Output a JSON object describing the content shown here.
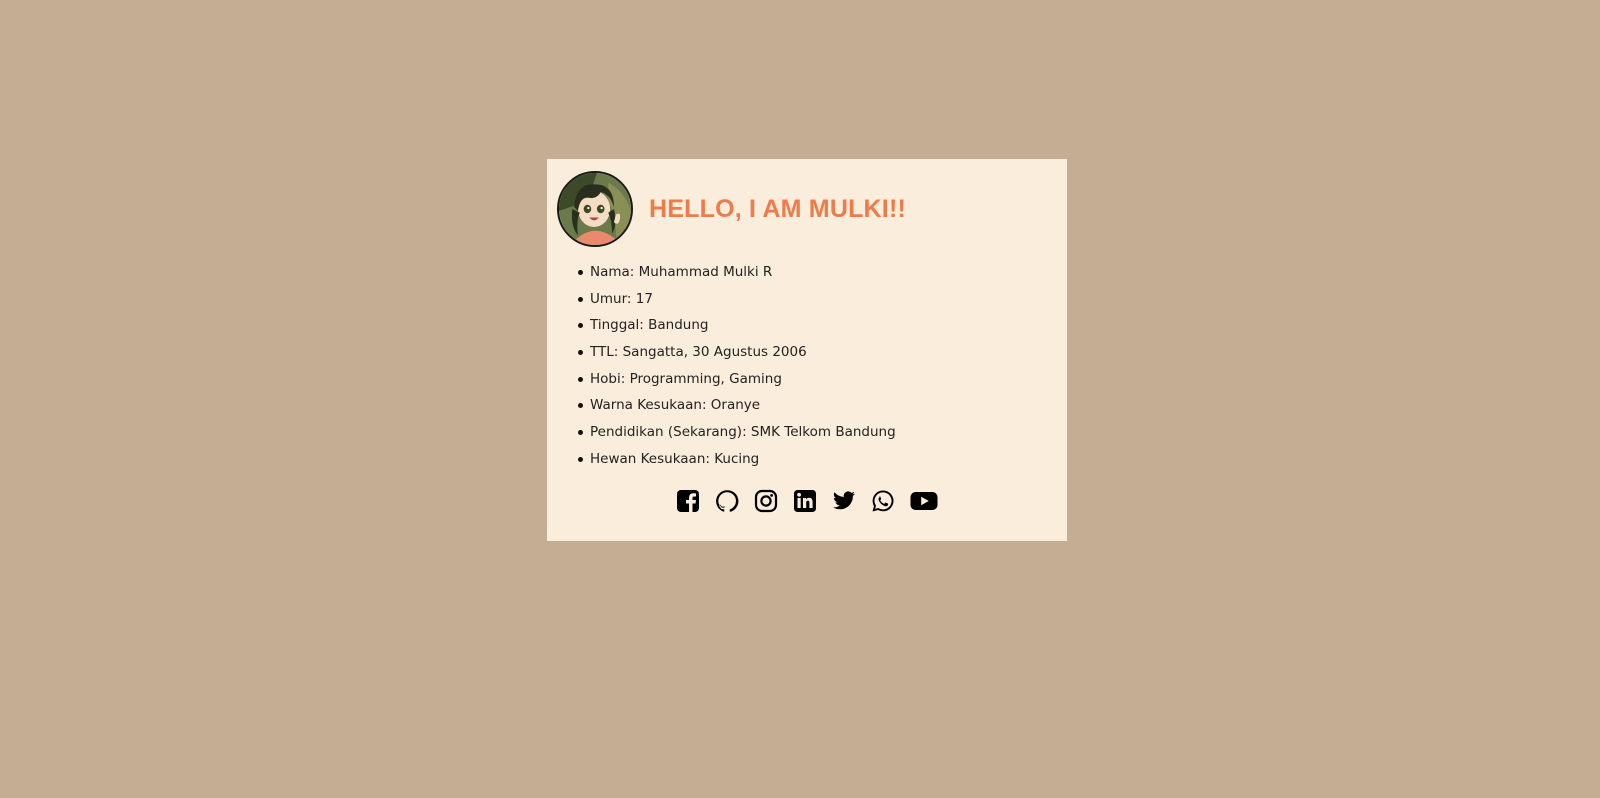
{
  "profile": {
    "title": "HELLO, I AM MULKI!!",
    "avatar_icon": "anime-avatar-icon",
    "colors": {
      "background": "#c4ae93",
      "card": "#fbeddc",
      "title": "#f07b4a"
    }
  },
  "info": {
    "items": [
      {
        "text": "Nama: Muhammad Mulki R"
      },
      {
        "text": "Umur: 17"
      },
      {
        "text": "Tinggal: Bandung"
      },
      {
        "text": "TTL: Sangatta, 30 Agustus 2006"
      },
      {
        "text": "Hobi: Programming, Gaming"
      },
      {
        "text": "Warna Kesukaan: Oranye"
      },
      {
        "text": "Pendidikan (Sekarang): SMK Telkom Bandung"
      },
      {
        "text": "Hewan Kesukaan: Kucing"
      }
    ]
  },
  "socials": [
    {
      "icon": "facebook-icon"
    },
    {
      "icon": "github-icon"
    },
    {
      "icon": "instagram-icon"
    },
    {
      "icon": "linkedin-icon"
    },
    {
      "icon": "twitter-icon"
    },
    {
      "icon": "whatsapp-icon"
    },
    {
      "icon": "youtube-icon"
    }
  ]
}
